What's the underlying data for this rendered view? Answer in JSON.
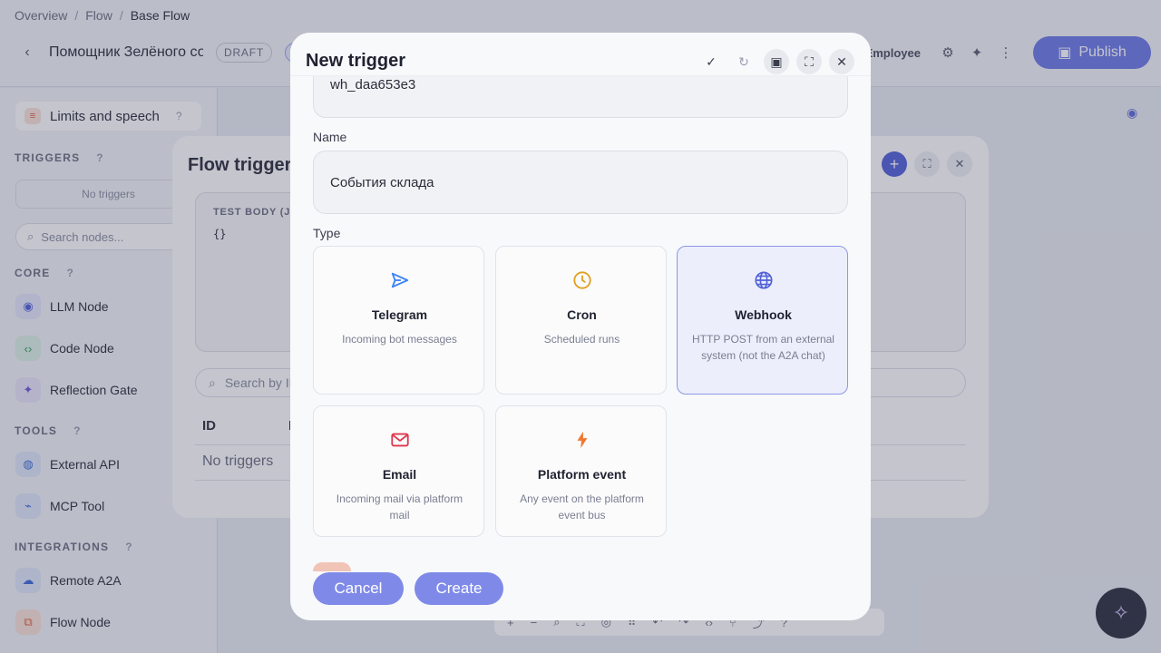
{
  "breadcrumb": {
    "items": [
      "Overview",
      "Flow"
    ],
    "current": "Base Flow",
    "separator": "/"
  },
  "flow_header": {
    "title": "Помощник Зелёного со",
    "status_badge": "DRAFT",
    "secondary_badge": "B",
    "employee_label": "Employee",
    "publish_label": "Publish"
  },
  "sidebar": {
    "limits_label": "Limits and speech",
    "help_mark": "?",
    "triggers_heading": "TRIGGERS",
    "no_triggers": "No triggers",
    "search_placeholder": "Search nodes...",
    "core_heading": "CORE",
    "core_items": [
      "LLM Node",
      "Code Node",
      "Reflection Gate"
    ],
    "tools_heading": "TOOLS",
    "tools_items": [
      "External API",
      "MCP Tool"
    ],
    "integrations_heading": "INTEGRATIONS",
    "integrations_items": [
      "Remote A2A",
      "Flow Node"
    ]
  },
  "flow_triggers_dialog": {
    "title": "Flow triggers",
    "test_body_label": "TEST BODY (JSON)",
    "test_body_value": "{}",
    "search_placeholder": "Search by ID",
    "columns": [
      "ID",
      "N"
    ],
    "empty_text": "No triggers"
  },
  "new_trigger_modal": {
    "title": "New trigger",
    "id_value": "wh_daa653e3",
    "name_label": "Name",
    "name_value": "События склада",
    "type_label": "Type",
    "types": [
      {
        "title": "Telegram",
        "desc": "Incoming bot messages",
        "icon": "send-icon",
        "color": "#3b82f6",
        "selected": false
      },
      {
        "title": "Cron",
        "desc": "Scheduled runs",
        "icon": "clock-icon",
        "color": "#e0a020",
        "selected": false
      },
      {
        "title": "Webhook",
        "desc": "HTTP POST from an external system (not the A2A chat)",
        "icon": "globe-icon",
        "color": "#5160d8",
        "selected": true
      },
      {
        "title": "Email",
        "desc": "Incoming mail via platform mail",
        "icon": "mail-icon",
        "color": "#e0364c",
        "selected": false
      },
      {
        "title": "Platform event",
        "desc": "Any event on the platform event bus",
        "icon": "bolt-icon",
        "color": "#f07830",
        "selected": false
      }
    ],
    "cancel_label": "Cancel",
    "create_label": "Create"
  },
  "colors": {
    "accent": "#5160d8",
    "button": "#7f8ae8"
  }
}
